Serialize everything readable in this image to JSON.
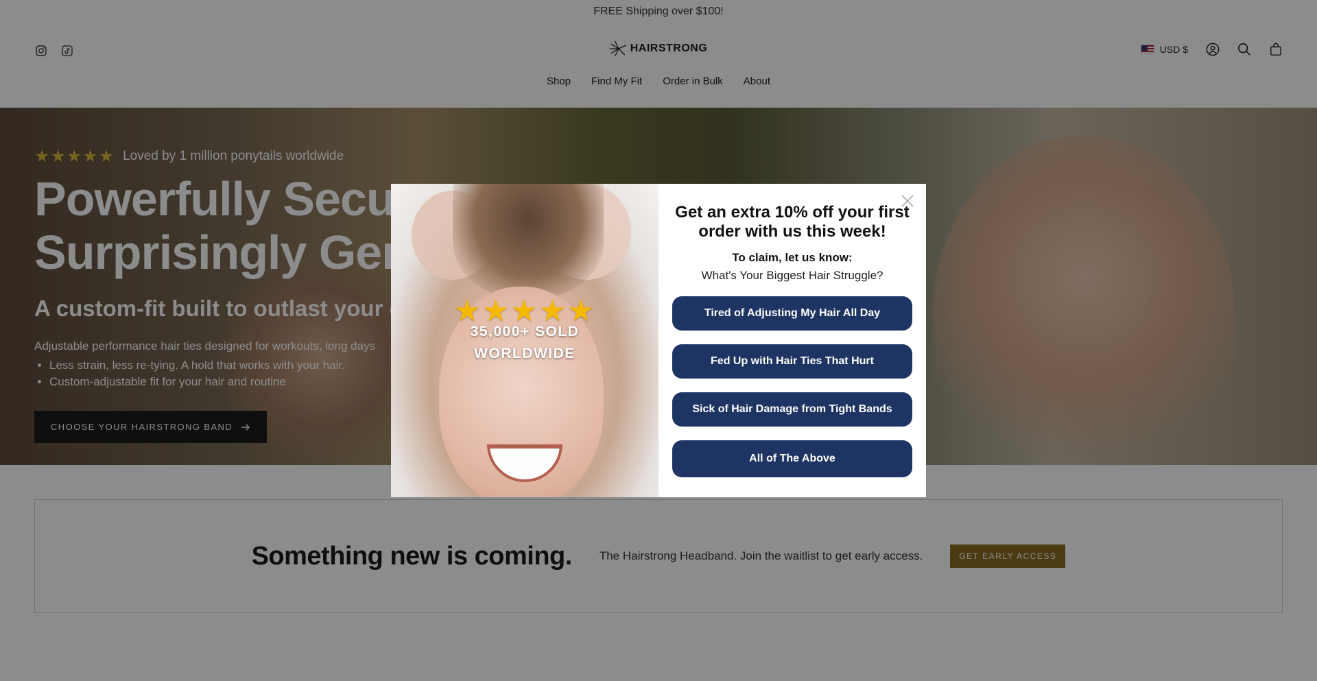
{
  "announcement": "FREE Shipping over $100!",
  "header": {
    "social": [
      {
        "icon": "instagram-icon"
      },
      {
        "icon": "tiktok-icon"
      }
    ],
    "logo_text": "HAIRSTRONG",
    "currency": "USD $",
    "nav": [
      "Shop",
      "Find My Fit",
      "Order in Bulk",
      "About"
    ]
  },
  "hero": {
    "stars": "★★★★★",
    "rating_text": "Loved by 1 million ponytails worldwide",
    "headline_line1": "Powerfully Secure.",
    "headline_line2": "Surprisingly Gentle.",
    "subhead": "A custom-fit built to outlast your day.",
    "description": "Adjustable performance hair ties designed for workouts, long days",
    "bullets": [
      "Less strain, less re-tying. A hold that works with your hair.",
      "Custom-adjustable fit for your hair and routine"
    ],
    "cta_label": "CHOOSE YOUR HAIRSTRONG BAND"
  },
  "banner": {
    "title": "Something new is coming.",
    "text": "The Hairstrong Headband. Join the waitlist to get early access.",
    "button": "GET EARLY ACCESS"
  },
  "modal": {
    "image_stars": "★★★★★",
    "image_sold_line1": "35,000+ SOLD",
    "image_sold_line2": "WORLDWIDE",
    "title": "Get an extra 10% off your first order with us this week!",
    "claim": "To claim, let us know:",
    "question": "What's Your Biggest Hair Struggle?",
    "options": [
      "Tired of Adjusting My Hair All Day",
      "Fed Up with Hair Ties That Hurt",
      "Sick of Hair Damage from Tight Bands",
      "All of The Above"
    ]
  },
  "colors": {
    "button_navy": "#1e3563",
    "star_gold": "#f5b800",
    "early_access_bg": "#8a6a24"
  }
}
